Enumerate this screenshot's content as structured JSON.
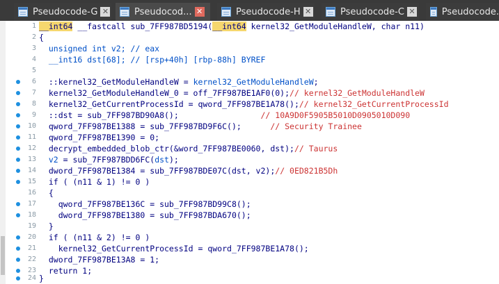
{
  "tabs": [
    {
      "label": "Pseudocode-G",
      "active": false
    },
    {
      "label": "Pseudocod...",
      "active": true
    },
    {
      "label": "Pseudocode-H",
      "active": false
    },
    {
      "label": "Pseudocode-C",
      "active": false
    },
    {
      "label": "Pseudocode.",
      "active": false
    }
  ],
  "close_glyph": "✕",
  "colors": {
    "breakpoint": "#1e90e0",
    "highlight": "#f5d76e",
    "comment_red": "#cc3333",
    "comment_blue": "#0050c8"
  },
  "lines": [
    {
      "n": "1",
      "bp": false
    },
    {
      "n": "2",
      "bp": false,
      "text": "{"
    },
    {
      "n": "3",
      "bp": false,
      "text": "  unsigned int v2; // eax"
    },
    {
      "n": "4",
      "bp": false,
      "text": "  __int16 dst[68]; // [rsp+40h] [rbp-88h] BYREF"
    },
    {
      "n": "5",
      "bp": false,
      "text": ""
    },
    {
      "n": "6",
      "bp": true
    },
    {
      "n": "7",
      "bp": true
    },
    {
      "n": "8",
      "bp": true
    },
    {
      "n": "9",
      "bp": true
    },
    {
      "n": "10",
      "bp": true
    },
    {
      "n": "11",
      "bp": true,
      "text": "  qword_7FF987BE1390 = 0;"
    },
    {
      "n": "12",
      "bp": true
    },
    {
      "n": "13",
      "bp": true
    },
    {
      "n": "14",
      "bp": true
    },
    {
      "n": "15",
      "bp": true,
      "text": "  if ( (n11 & 1) != 0 )"
    },
    {
      "n": "16",
      "bp": false,
      "text": "  {"
    },
    {
      "n": "17",
      "bp": true,
      "text": "    qword_7FF987BE136C = sub_7FF987BD99C8();"
    },
    {
      "n": "18",
      "bp": true,
      "text": "    dword_7FF987BE1380 = sub_7FF987BDA670();"
    },
    {
      "n": "19",
      "bp": false,
      "text": "  }"
    },
    {
      "n": "20",
      "bp": true,
      "text": "  if ( (n11 & 2) != 0 )"
    },
    {
      "n": "21",
      "bp": true,
      "text": "    kernel32_GetCurrentProcessId = qword_7FF987BE1A78();"
    },
    {
      "n": "22",
      "bp": true,
      "text": "  dword_7FF987BE13A8 = 1;"
    },
    {
      "n": "23",
      "bp": true,
      "text": "  return 1;"
    },
    {
      "n": "24",
      "bp": true,
      "text": "}"
    }
  ],
  "line1": {
    "a": "__int64",
    "b": " __fastcall sub_7FF987BD5194(",
    "c": "__int64",
    "d": " kernel32_GetModuleHandleW, char n11)"
  },
  "line6": {
    "a": "  ::kernel32_GetModuleHandleW = ",
    "b": "kernel32_GetModuleHandleW",
    "c": ";"
  },
  "line7": {
    "a": "  kernel32_GetModuleHandleW_0 = off_7FF987BE1AF0(0);",
    "b": "// kernel32_GetModuleHandleW"
  },
  "line8": {
    "a": "  kernel32_GetCurrentProcessId = qword_7FF987BE1A78();",
    "b": "// kernel32_GetCurrentProcessId"
  },
  "line9": {
    "a": "  ::dst = sub_7FF987BD90A8();                 ",
    "b": "// 10A9D0F5905B5010D0905010D090"
  },
  "line10": {
    "a": "  qword_7FF987BE1388 = sub_7FF987BD9F6C();      ",
    "b": "// Security Trainee"
  },
  "line12": {
    "a": "  decrypt_embedded_blob_ctr(&word_7FF987BE0060, dst);",
    "b": "// Taurus"
  },
  "line13": {
    "a": "  ",
    "b": "v2",
    "c": " = sub_7FF987BDD6FC(",
    "d": "dst",
    "e": ");"
  },
  "line14": {
    "a": "  dword_7FF987BE1384 = sub_7FF987BDE07C(dst, v2);",
    "b": "// 0ED821B5Dh"
  }
}
